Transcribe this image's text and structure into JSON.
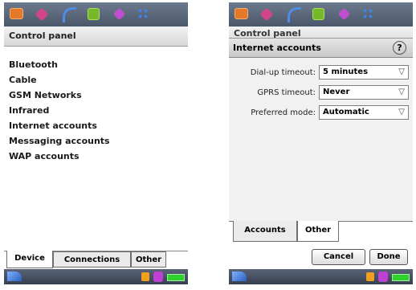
{
  "left": {
    "title": "Control panel",
    "items": [
      "Bluetooth",
      "Cable",
      "GSM Networks",
      "Infrared",
      "Internet accounts",
      "Messaging accounts",
      "WAP accounts"
    ],
    "tabs": [
      "Device",
      "Connections",
      "Other"
    ],
    "active_tab": "Device"
  },
  "right": {
    "underlying_title": "Control panel",
    "dialog_title": "Internet accounts",
    "help_symbol": "?",
    "fields": [
      {
        "label": "Dial-up timeout:",
        "value": "5 minutes"
      },
      {
        "label": "GPRS timeout:",
        "value": "Never"
      },
      {
        "label": "Preferred mode:",
        "value": "Automatic"
      }
    ],
    "tabs": [
      "Accounts",
      "Other"
    ],
    "active_tab": "Other",
    "buttons": {
      "cancel": "Cancel",
      "done": "Done"
    }
  },
  "colors": {
    "topbar": "#5b6779",
    "statusbar": "#444e5e",
    "battery": "#2fd12f"
  },
  "icons": [
    "mail-icon",
    "contacts-icon",
    "phone-icon",
    "calendar-icon",
    "diamond-icon",
    "grid-icon",
    "menu-icon",
    "volume-icon",
    "network-icon",
    "battery-icon"
  ]
}
